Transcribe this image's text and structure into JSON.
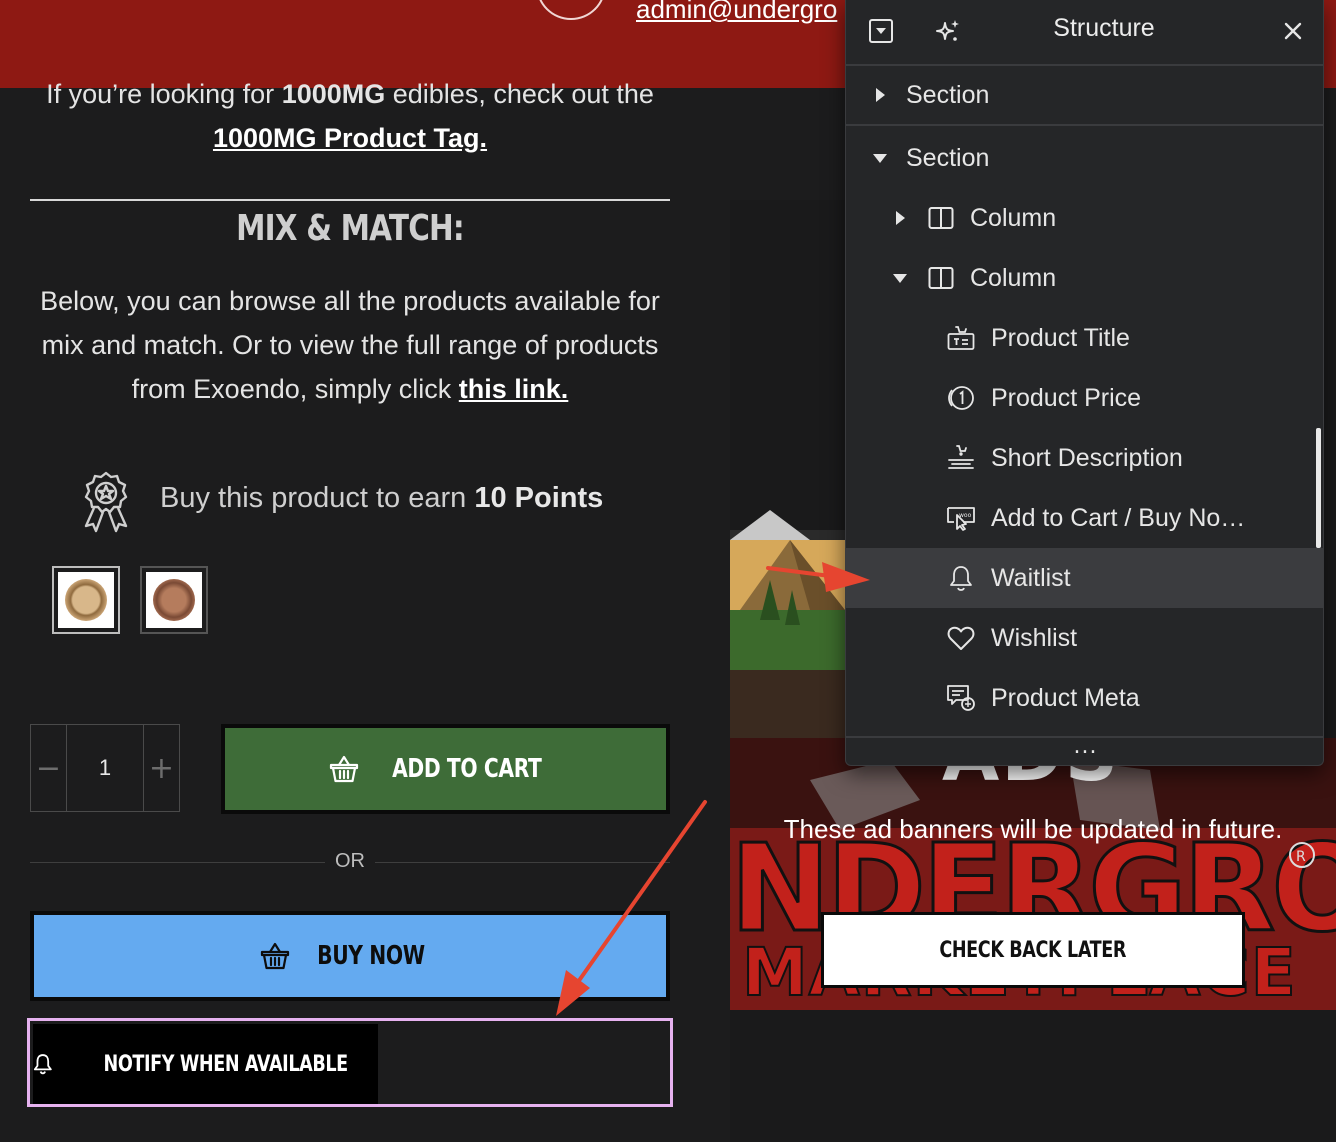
{
  "header": {
    "email": "admin@undergro"
  },
  "intro": {
    "line1_pre": "If you’re looking for ",
    "line1_bold": "1000MG",
    "line1_post": " edibles, check out the",
    "tag_link": "1000MG Product Tag."
  },
  "mix": {
    "heading": "MIX & MATCH:",
    "text": "Below, you can browse all the products available for mix and match. Or to view the full range of products from Exoendo, simply click ",
    "link": "this link."
  },
  "points": {
    "pre": "Buy this product to earn ",
    "bold": "10 Points"
  },
  "quantity": {
    "minus": "−",
    "value": "1",
    "plus": "+"
  },
  "buttons": {
    "add_to_cart": "ADD TO CART",
    "or": "OR",
    "buy_now": "BUY NOW",
    "notify": "NOTIFY WHEN AVAILABLE",
    "check_back": "CHECK BACK LATER"
  },
  "banner": {
    "ads_title": "ADS",
    "caption": "These ad banners will be updated in future."
  },
  "panel": {
    "title": "Structure",
    "more": "...",
    "items": [
      {
        "label": "Section",
        "icon": "caret-right"
      },
      {
        "label": "Section",
        "icon": "caret-down"
      },
      {
        "label": "Column",
        "icon": "column-icon"
      },
      {
        "label": "Column",
        "icon": "column-icon"
      },
      {
        "label": "Product Title",
        "icon": "product-title-icon"
      },
      {
        "label": "Product Price",
        "icon": "product-price-icon"
      },
      {
        "label": "Short Description",
        "icon": "short-description-icon"
      },
      {
        "label": "Add to Cart / Buy No…",
        "icon": "add-to-cart-icon"
      },
      {
        "label": "Waitlist",
        "icon": "bell-icon"
      },
      {
        "label": "Wishlist",
        "icon": "heart-icon"
      },
      {
        "label": "Product Meta",
        "icon": "product-meta-icon"
      }
    ]
  },
  "colors": {
    "header_red": "#8e1913",
    "add_to_cart_green": "#3e6c38",
    "buy_now_blue": "#64aaf0",
    "notify_frame": "#e6b2ef",
    "annotation_arrow": "#e64530"
  }
}
